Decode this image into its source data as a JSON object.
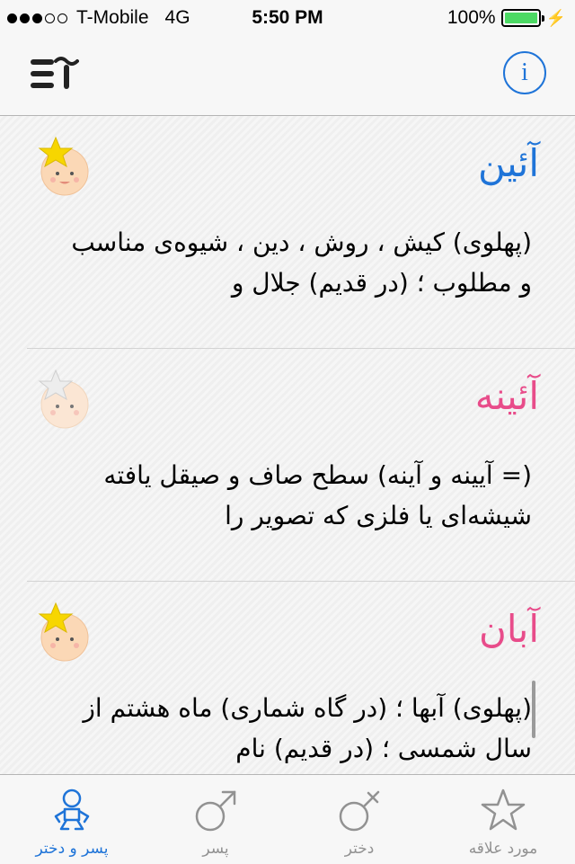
{
  "status_bar": {
    "carrier": "T-Mobile",
    "network": "4G",
    "time": "5:50 PM",
    "battery": "100%",
    "signal_bars": 3,
    "signal_total": 5,
    "battery_level": 1.0
  },
  "navbar": {
    "menu_icon": "text-lines-alef-icon",
    "info_label": "i"
  },
  "names": [
    {
      "name": "آئین",
      "gender": "boy",
      "favorite": true,
      "description": "(پهلوی) کیش ، روش ، دین ، شیوه‌ی مناسب و مطلوب ؛ (در قدیم) جلال و"
    },
    {
      "name": "آئینه",
      "gender": "girl",
      "favorite": false,
      "description": "(= آیینه و آینه) سطح صاف و صیقل یافته شیشه‌ای یا فلزی که تصویر را"
    },
    {
      "name": "آبان",
      "gender": "girl",
      "favorite": true,
      "description": "(پهلوی) آبها ؛ (در گاه شماری) ماه هشتم از سال شمسی ؛ (در قدیم) نام"
    }
  ],
  "colors": {
    "boy": "#1f74d8",
    "girl": "#e84c8a",
    "accent": "#1f74d8",
    "inactive": "#929292"
  },
  "tabs": [
    {
      "label": "پسر و دختر",
      "icon": "baby-icon",
      "active": true
    },
    {
      "label": "پسر",
      "icon": "male-symbol-icon",
      "active": false
    },
    {
      "label": "دختر",
      "icon": "female-symbol-icon",
      "active": false
    },
    {
      "label": "مورد علاقه",
      "icon": "star-icon",
      "active": false
    }
  ]
}
